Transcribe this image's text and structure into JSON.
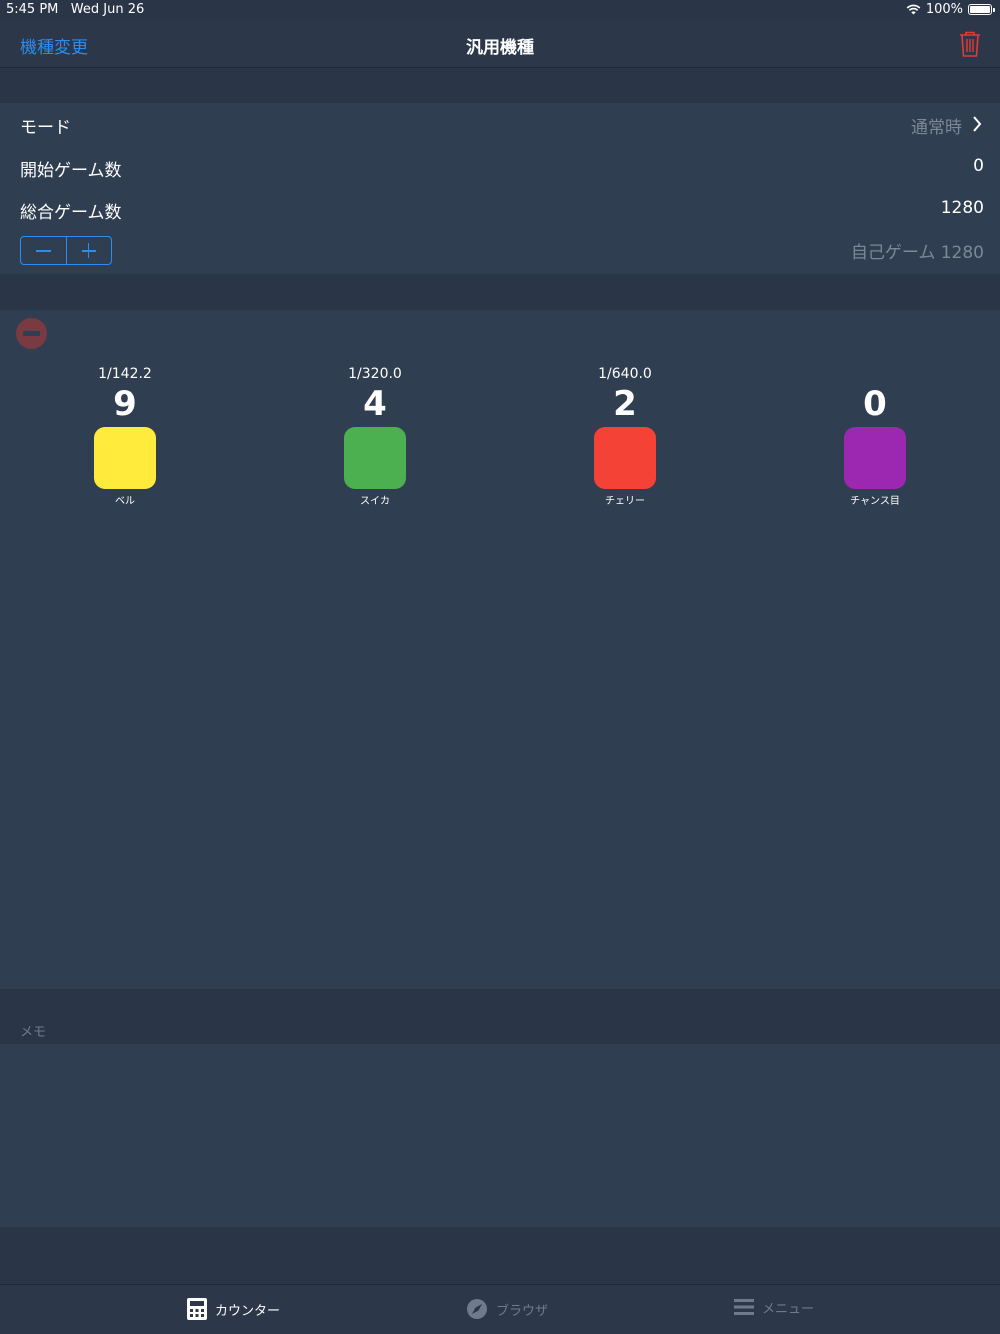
{
  "status": {
    "time": "5:45 PM",
    "date": "Wed Jun 26",
    "battery": "100%"
  },
  "nav": {
    "left_label": "機種変更",
    "title": "汎用機種",
    "trash_icon": "trash-icon"
  },
  "settings": {
    "mode_label": "モード",
    "mode_value": "通常時",
    "start_games_label": "開始ゲーム数",
    "start_games_value": "0",
    "total_games_label": "総合ゲーム数",
    "total_games_value": "1280",
    "self_games": "自己ゲーム 1280"
  },
  "counters": [
    {
      "name": "ベル",
      "prob": "1/142.2",
      "count": "9",
      "color": "#ffeb3b"
    },
    {
      "name": "スイカ",
      "prob": "1/320.0",
      "count": "4",
      "color": "#4caf50"
    },
    {
      "name": "チェリー",
      "prob": "1/640.0",
      "count": "2",
      "color": "#f44336"
    },
    {
      "name": "チャンス目",
      "prob": "",
      "count": "0",
      "color": "#9c27b0"
    }
  ],
  "memo": {
    "label": "メモ"
  },
  "tabs": [
    {
      "label": "カウンター",
      "icon": "calculator-icon",
      "active": true
    },
    {
      "label": "ブラウザ",
      "icon": "compass-icon",
      "active": false
    },
    {
      "label": "メニュー",
      "icon": "menu-icon",
      "active": false
    }
  ],
  "colors": {
    "accent": "#2d8cf0",
    "danger": "#e53935",
    "background": "#2a3647",
    "cell": "#2f3e51"
  }
}
